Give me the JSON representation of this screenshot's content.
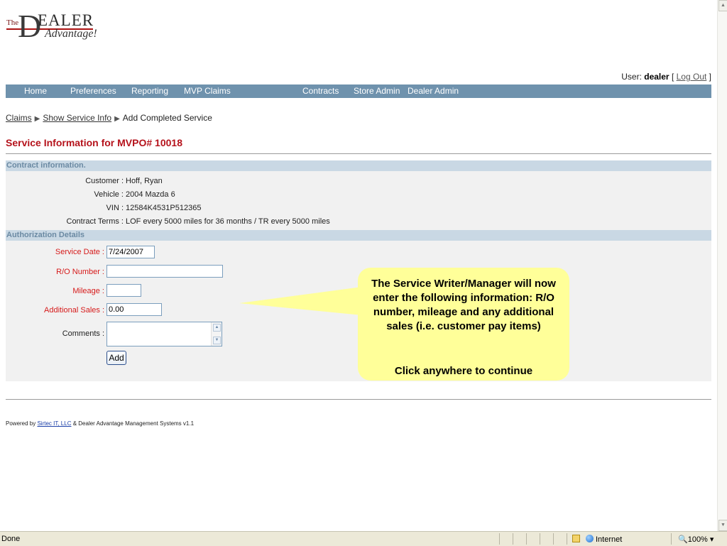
{
  "logo": {
    "the": "The",
    "d": "D",
    "ealer": "EALER",
    "advantage": "Advantage!"
  },
  "user": {
    "prefix": "User: ",
    "name": "dealer",
    "open": " [ ",
    "logout": "Log Out",
    "close": " ]"
  },
  "nav": [
    {
      "label": "Home"
    },
    {
      "label": "Preferences"
    },
    {
      "label": "Reporting"
    },
    {
      "label": "MVP Claims"
    },
    {
      "label": "Contracts"
    },
    {
      "label": "Store Admin"
    },
    {
      "label": "Dealer Admin"
    }
  ],
  "breadcrumb": {
    "claims": "Claims",
    "show_service": "Show Service Info",
    "current": "Add Completed Service",
    "arrow": "▶"
  },
  "page_title": "Service Information for MVPO# 10018",
  "contract": {
    "header": "Contract information.",
    "rows": [
      {
        "label": "Customer :",
        "value": "Hoff, Ryan"
      },
      {
        "label": "Vehicle :",
        "value": "2004 Mazda 6"
      },
      {
        "label": "VIN :",
        "value": "12584K4531P512365"
      },
      {
        "label": "Contract Terms :",
        "value": "LOF every 5000 miles for 36 months / TR every 5000 miles"
      }
    ]
  },
  "auth": {
    "header": "Authorization Details",
    "service_date_label": "Service Date :",
    "service_date_value": "7/24/2007",
    "ro_label": "R/O Number :",
    "ro_value": "",
    "mileage_label": "Mileage :",
    "mileage_value": "",
    "additional_sales_label": "Additional Sales :",
    "additional_sales_value": "0.00",
    "comments_label": "Comments :",
    "add_button": "Add"
  },
  "callout": {
    "line1": "The Service Writer/Manager will now enter the following information: R/O number, mileage and any additional sales (i.e. customer pay items)",
    "line2": "Click anywhere to continue"
  },
  "footer": {
    "prefix": "Powered by ",
    "link": "Sirtec IT, LLC",
    "suffix": " & Dealer Advantage Management Systems v1.1"
  },
  "statusbar": {
    "done": "Done",
    "zone": "Internet",
    "zoom": "100%"
  },
  "colors": {
    "nav": "#6f92ad",
    "title_red": "#b5121b",
    "required_red": "#d61a1a",
    "section_bg": "#c9d8e4",
    "callout": "#ffff99"
  }
}
